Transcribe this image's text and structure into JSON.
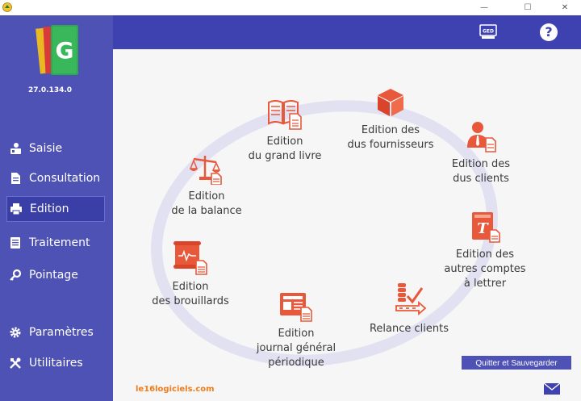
{
  "app": {
    "version": "27.0.134.0"
  },
  "titlebar": {
    "minimize": "—",
    "maximize": "☐",
    "close": "✕"
  },
  "sidebar": {
    "items": [
      {
        "label": "Saisie",
        "icon": "user-desk-icon",
        "active": false
      },
      {
        "label": "Consultation",
        "icon": "document-icon",
        "active": false
      },
      {
        "label": "Edition",
        "icon": "printer-icon",
        "active": true
      },
      {
        "label": "Traitement",
        "icon": "tasks-icon",
        "active": false
      },
      {
        "label": "Pointage",
        "icon": "key-icon",
        "active": false
      },
      {
        "label": "Paramètres",
        "icon": "gear-icon",
        "active": false
      },
      {
        "label": "Utilitaires",
        "icon": "tools-icon",
        "active": false
      }
    ]
  },
  "topbar": {
    "ged_label": "GED",
    "help_label": "?"
  },
  "main": {
    "items": [
      {
        "label": "Edition\ndu grand livre",
        "icon": "book-document-icon"
      },
      {
        "label": "Edition des\ndus fournisseurs",
        "icon": "package-box-icon"
      },
      {
        "label": "Edition des\ndus clients",
        "icon": "client-person-icon"
      },
      {
        "label": "Edition\nde la balance",
        "icon": "balance-scale-icon"
      },
      {
        "label": "Edition des\nautres comptes\nà lettrer",
        "icon": "ledger-letter-icon"
      },
      {
        "label": "Edition\ndes brouillards",
        "icon": "draft-scroll-icon"
      },
      {
        "label": "Relance clients",
        "icon": "coins-reminder-icon"
      },
      {
        "label": "Edition\njournal général\npériodique",
        "icon": "journal-icon"
      }
    ],
    "quit_button": "Quitter et Sauvegarder",
    "site": "le16logiciels.com"
  },
  "colors": {
    "sidebar": "#4f52b5",
    "topbar": "#3e41b0",
    "accent": "#e8583a",
    "site": "#f07c1c"
  }
}
